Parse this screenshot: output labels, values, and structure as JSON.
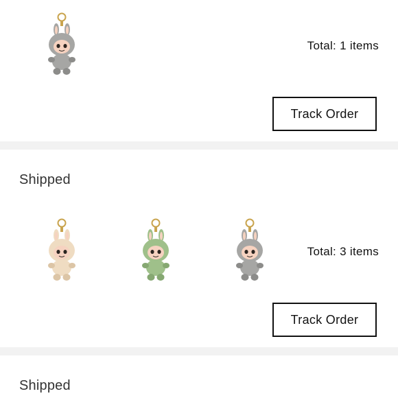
{
  "orders": [
    {
      "status": "",
      "total_text": "Total: 1 items",
      "track_label": "Track Order",
      "items": [
        {
          "name": "grey-bunny-plush-keychain",
          "fur": "#a6a6a4",
          "fur_dark": "#8c8c8a"
        }
      ]
    },
    {
      "status": "Shipped",
      "total_text": "Total: 3 items",
      "track_label": "Track Order",
      "items": [
        {
          "name": "cream-bunny-plush-keychain",
          "fur": "#efdcc2",
          "fur_dark": "#dcc5a6"
        },
        {
          "name": "green-bunny-plush-keychain",
          "fur": "#9fc08a",
          "fur_dark": "#86a872"
        },
        {
          "name": "grey-bunny-plush-keychain",
          "fur": "#a6a6a4",
          "fur_dark": "#8c8c8a"
        }
      ]
    },
    {
      "status": "Shipped"
    }
  ],
  "colors": {
    "divider": "#f2f2f2",
    "face": "#f6d2c0",
    "ring": "#c9a44e",
    "eye": "#2b2420"
  }
}
